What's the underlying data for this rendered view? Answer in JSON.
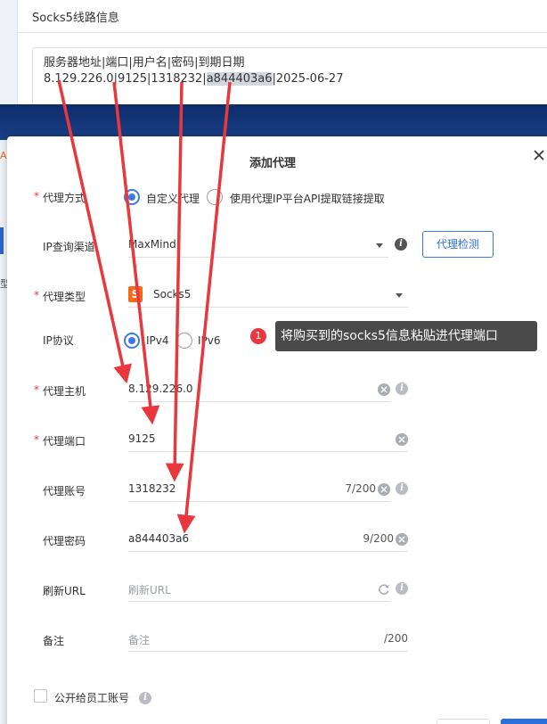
{
  "background": {
    "section_title": "Socks5线路信息",
    "text_line1": "服务器地址|端口|用户名|密码|到期日期",
    "text_line2_pre": "8.129.226.0|9125|1318232|",
    "text_line2_hl": "a844403a6",
    "text_line2_post": "|2025-06-27",
    "side_text1": "A",
    "side_text2": "型"
  },
  "modal": {
    "title": "添加代理",
    "rows": {
      "proxy_mode": {
        "label": "代理方式",
        "option_custom": "自定义代理",
        "option_api": "使用代理IP平台API提取链接提取",
        "selected": "自定义代理"
      },
      "ip_channel": {
        "label": "IP查询渠道",
        "value": "MaxMind",
        "check_button": "代理检测"
      },
      "proxy_type": {
        "label": "代理类型",
        "icon_letter": "S",
        "value": "Socks5"
      },
      "ip_protocol": {
        "label": "IP协议",
        "option_v4": "IPv4",
        "option_v6": "IPv6",
        "selected": "IPv4"
      },
      "proxy_host": {
        "label": "代理主机",
        "value": "8.129.226.0"
      },
      "proxy_port": {
        "label": "代理端口",
        "value": "9125"
      },
      "proxy_account": {
        "label": "代理账号",
        "value": "1318232",
        "count": "7/200"
      },
      "proxy_password": {
        "label": "代理密码",
        "value": "a844403a6",
        "count": "9/200"
      },
      "refresh_url": {
        "label": "刷新URL",
        "placeholder": "刷新URL"
      },
      "remark": {
        "label": "备注",
        "placeholder": "备注",
        "count": "/200"
      },
      "public_checkbox": {
        "label": "公开给员工账号",
        "checked": false
      }
    },
    "required_mark": "*"
  },
  "annotation": {
    "step_number": "1",
    "text": "将购买到的socks5信息粘贴进代理端口"
  },
  "colors": {
    "accent": "#3b7be6",
    "arrow": "#e8383d",
    "tooltip_bg": "#4a4a4a",
    "socks_icon": "#f26b1d"
  }
}
